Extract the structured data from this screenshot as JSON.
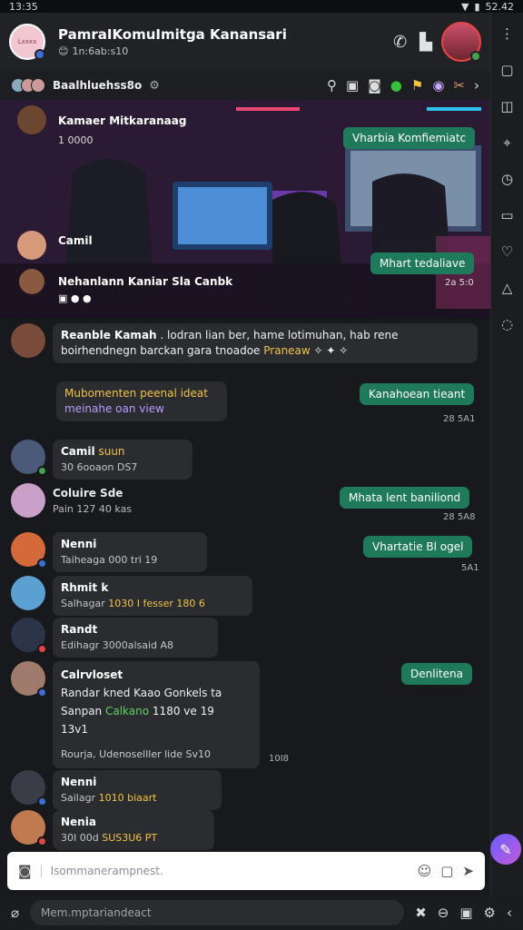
{
  "status": {
    "time": "13:35",
    "battery": "52.42"
  },
  "header": {
    "title": "PamraIKomuImitga Kanansari",
    "subtitle": "1n:6ab:s10",
    "group_badge": "Lxxxx"
  },
  "subbar": {
    "label": "Baalhluehss8o"
  },
  "hero": {
    "user1": "Kamaer Mitkaranaag",
    "user1_sub": "1 0000",
    "user2": "Camil",
    "user3": "Nehanlann Kaniar Sla Canbk",
    "pill1": "Vharbia Komfiemiatc",
    "pill2": "Mhart tedaliave",
    "pill2_time": "2a 5:0"
  },
  "messages": [
    {
      "name": "Reanble Kamah",
      "text": ". lodran lian ber, hame lotimuhan, hab rene boirhendnegn barckan gara tnoadoe",
      "gold": "Praneaw"
    },
    {
      "card1": "Mubomenten peenal ideat",
      "card2": "meinahe oan view"
    },
    {
      "name": "Camil",
      "badge": "suun",
      "text": "30 6ooaon",
      "extra": "DS7"
    },
    {
      "name": "Coluire Sde",
      "text": "Pain 127 40 kas"
    },
    {
      "name": "Nenni",
      "text": "Taiheaga",
      "extra": "000 tri 19"
    },
    {
      "name": "Rhmit k",
      "text": "Salhagar",
      "extra": "1030 I fesser 180 6"
    },
    {
      "name": "Randt",
      "text": "Edihagr",
      "extra": "3000alsaid A8"
    },
    {
      "name": "Calrvloset",
      "l1": "Randar kned Kaao Gonkels ta",
      "l2a": "Sanpan",
      "l2b": "Calkano",
      "l2c": "1180 ve 19",
      "l3": "13v1",
      "l4": "Rourja, Udenoselller lide Sv10"
    },
    {
      "name": "Nenni",
      "text": "Sailagr",
      "extra": "1010 biaart"
    },
    {
      "name": "Nenia",
      "text": "30I 00d",
      "extra": "SUS3U6 PT"
    }
  ],
  "outgoing": [
    {
      "text": "Kanahoean tieant",
      "time": "28 5A1"
    },
    {
      "text": "Mhata lent baniliond",
      "time": "28 5A8"
    },
    {
      "text": "Vhartatie Bl ogel",
      "time": "5A1"
    },
    {
      "text": "Denlitena",
      "time": "10I8"
    }
  ],
  "composer": {
    "placeholder": "Isommanerampnest."
  },
  "bottom": {
    "placeholder": "Mem.mptariandeact"
  }
}
